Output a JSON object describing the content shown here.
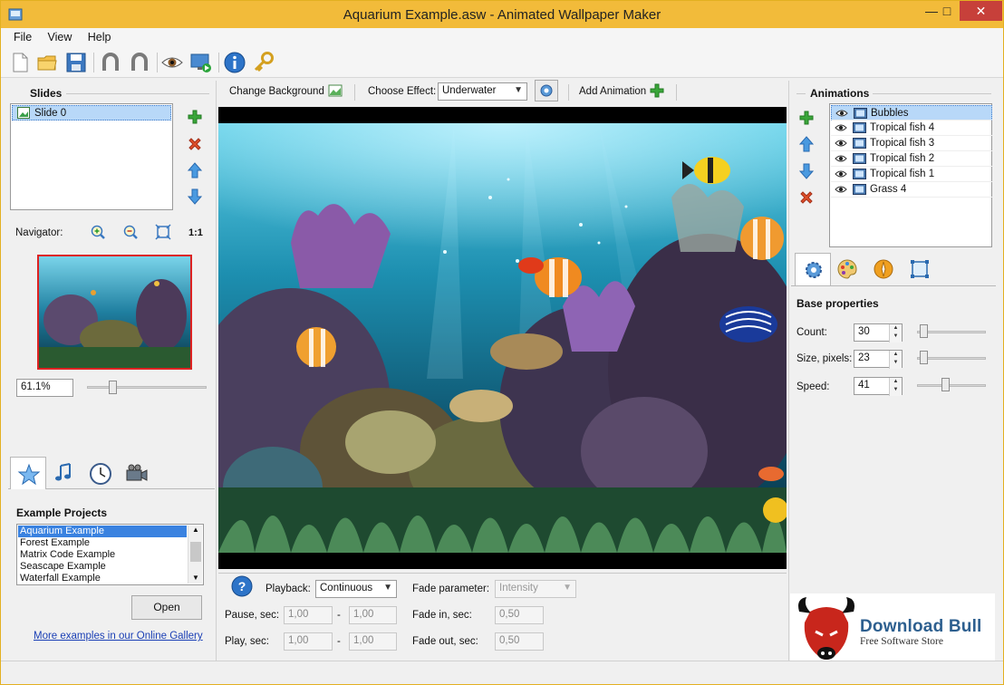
{
  "window": {
    "title": "Aquarium Example.asw - Animated Wallpaper Maker"
  },
  "menu": [
    "File",
    "View",
    "Help"
  ],
  "slides": {
    "heading": "Slides",
    "items": [
      "Slide 0"
    ],
    "navigator_label": "Navigator:",
    "zoom_one_label": "1:1",
    "zoom_value": "61.1%"
  },
  "left_tabs": [
    "star-icon",
    "music-icon",
    "clock-icon",
    "camera-icon"
  ],
  "examples": {
    "heading": "Example Projects",
    "items": [
      "Aquarium Example",
      "Forest Example",
      "Matrix Code Example",
      "Seascape Example",
      "Waterfall Example"
    ],
    "open_label": "Open",
    "gallery_link": "More examples in our Online Gallery"
  },
  "center_toolbar": {
    "change_bg_label": "Change Background",
    "choose_effect_label": "Choose Effect:",
    "effect_value": "Underwater",
    "add_animation_label": "Add Animation"
  },
  "playback": {
    "playback_label": "Playback:",
    "playback_value": "Continuous",
    "pause_label": "Pause, sec:",
    "pause_from": "1,00",
    "pause_to": "1,00",
    "play_label": "Play, sec:",
    "play_from": "1,00",
    "play_to": "1,00",
    "dash": "-",
    "fade_param_label": "Fade parameter:",
    "fade_param_value": "Intensity",
    "fade_in_label": "Fade in, sec:",
    "fade_in_value": "0,50",
    "fade_out_label": "Fade out, sec:",
    "fade_out_value": "0,50"
  },
  "animations": {
    "heading": "Animations",
    "items": [
      "Bubbles",
      "Tropical fish 4",
      "Tropical fish 3",
      "Tropical fish 2",
      "Tropical fish 1",
      "Grass 4"
    ]
  },
  "properties": {
    "heading": "Base properties",
    "count_label": "Count:",
    "count_value": "30",
    "size_label": "Size, pixels:",
    "size_value": "23",
    "speed_label": "Speed:",
    "speed_value": "41"
  },
  "watermark": {
    "brand": "Download Bull",
    "tagline": "Free Software Store"
  },
  "colors": {
    "titlebar": "#f2bb3a",
    "selection": "#b8d8f8",
    "link": "#1a3fb5",
    "close": "#c7403a"
  }
}
